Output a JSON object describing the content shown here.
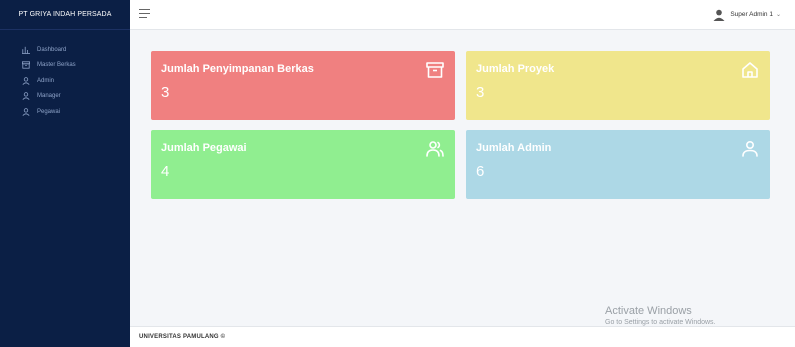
{
  "sidebar": {
    "brand": "PT GRIYA INDAH PERSADA",
    "items": [
      {
        "label": "Dashboard",
        "icon": "dashboard-icon"
      },
      {
        "label": "Master Berkas",
        "icon": "archive-icon"
      },
      {
        "label": "Admin",
        "icon": "user-icon"
      },
      {
        "label": "Manager",
        "icon": "user-icon"
      },
      {
        "label": "Pegawai",
        "icon": "user-icon"
      }
    ]
  },
  "topbar": {
    "user_name": "Super Admin 1",
    "caret": "⌄"
  },
  "cards": [
    {
      "title": "Jumlah Penyimpanan Berkas",
      "value": "3",
      "color": "#f08080",
      "icon": "archive-box-icon"
    },
    {
      "title": "Jumlah Proyek",
      "value": "3",
      "color": "#f0e68c",
      "icon": "home-icon"
    },
    {
      "title": "Jumlah Pegawai",
      "value": "4",
      "color": "#90ee90",
      "icon": "users-icon"
    },
    {
      "title": "Jumlah Admin",
      "value": "6",
      "color": "#add8e6",
      "icon": "user-icon"
    }
  ],
  "footer": {
    "text": "UNIVERSITAS PAMULANG ©"
  },
  "watermark": {
    "title": "Activate Windows",
    "subtitle": "Go to Settings to activate Windows."
  }
}
